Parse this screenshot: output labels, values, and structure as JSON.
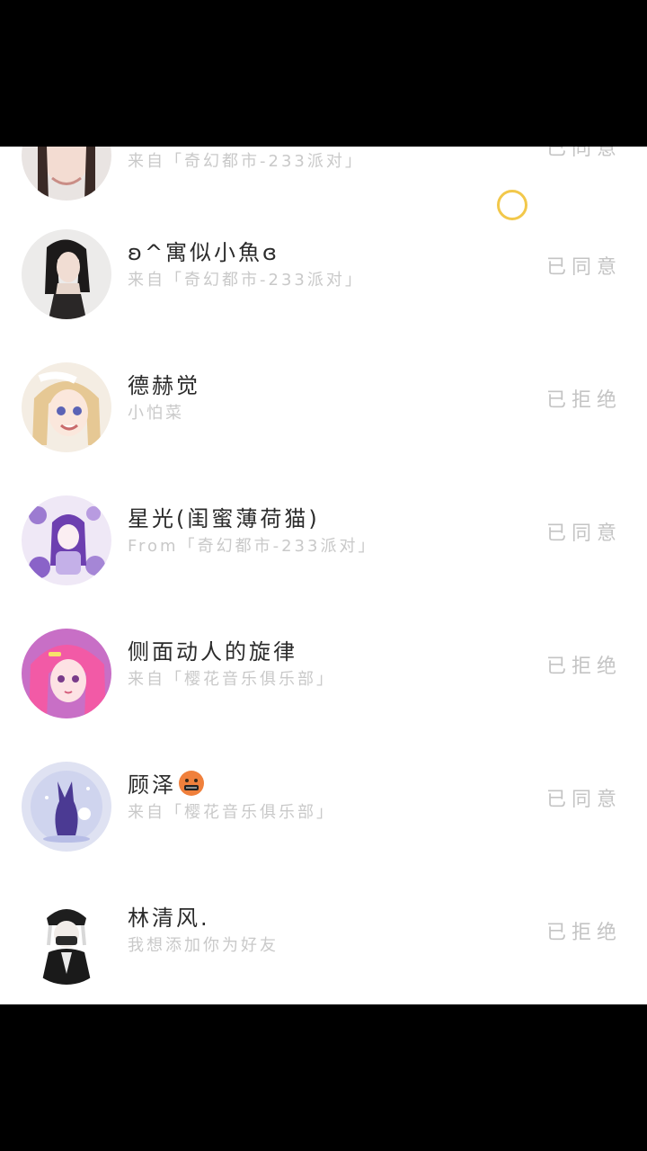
{
  "requests": [
    {
      "name": "",
      "source": "来自「奇幻都市-233派对」",
      "status": "已同意",
      "avatar": "girl-photo-avatar"
    },
    {
      "name": "ʚ^寓似小魚ɞ",
      "source": "来自「奇幻都市-233派对」",
      "status": "已同意",
      "avatar": "girl-photo-avatar"
    },
    {
      "name": "德赫觉",
      "source": "小怕菜",
      "status": "已拒绝",
      "avatar": "anime-girl-avatar"
    },
    {
      "name": "星光(闺蜜薄荷猫)",
      "source": "From「奇幻都市-233派对」",
      "status": "已同意",
      "avatar": "purple-anime-avatar"
    },
    {
      "name": "侧面动人的旋律",
      "source": "来自「樱花音乐俱乐部」",
      "status": "已拒绝",
      "avatar": "pink-hair-anime-avatar"
    },
    {
      "name": "顾泽",
      "source": "来自「樱花音乐俱乐部」",
      "status": "已同意",
      "avatar": "fantasy-creature-avatar",
      "emoji": "cursing-face-emoji"
    },
    {
      "name": "林清风.",
      "source": "我想添加你为好友",
      "status": "已拒绝",
      "avatar": "dark-anime-boy-avatar"
    }
  ],
  "colors": {
    "background": "#ffffff",
    "name_text": "#2b2b2b",
    "sub_text": "#c9c9c9",
    "status_text": "#c4c4c4",
    "touch_ring": "#f2c84b"
  }
}
